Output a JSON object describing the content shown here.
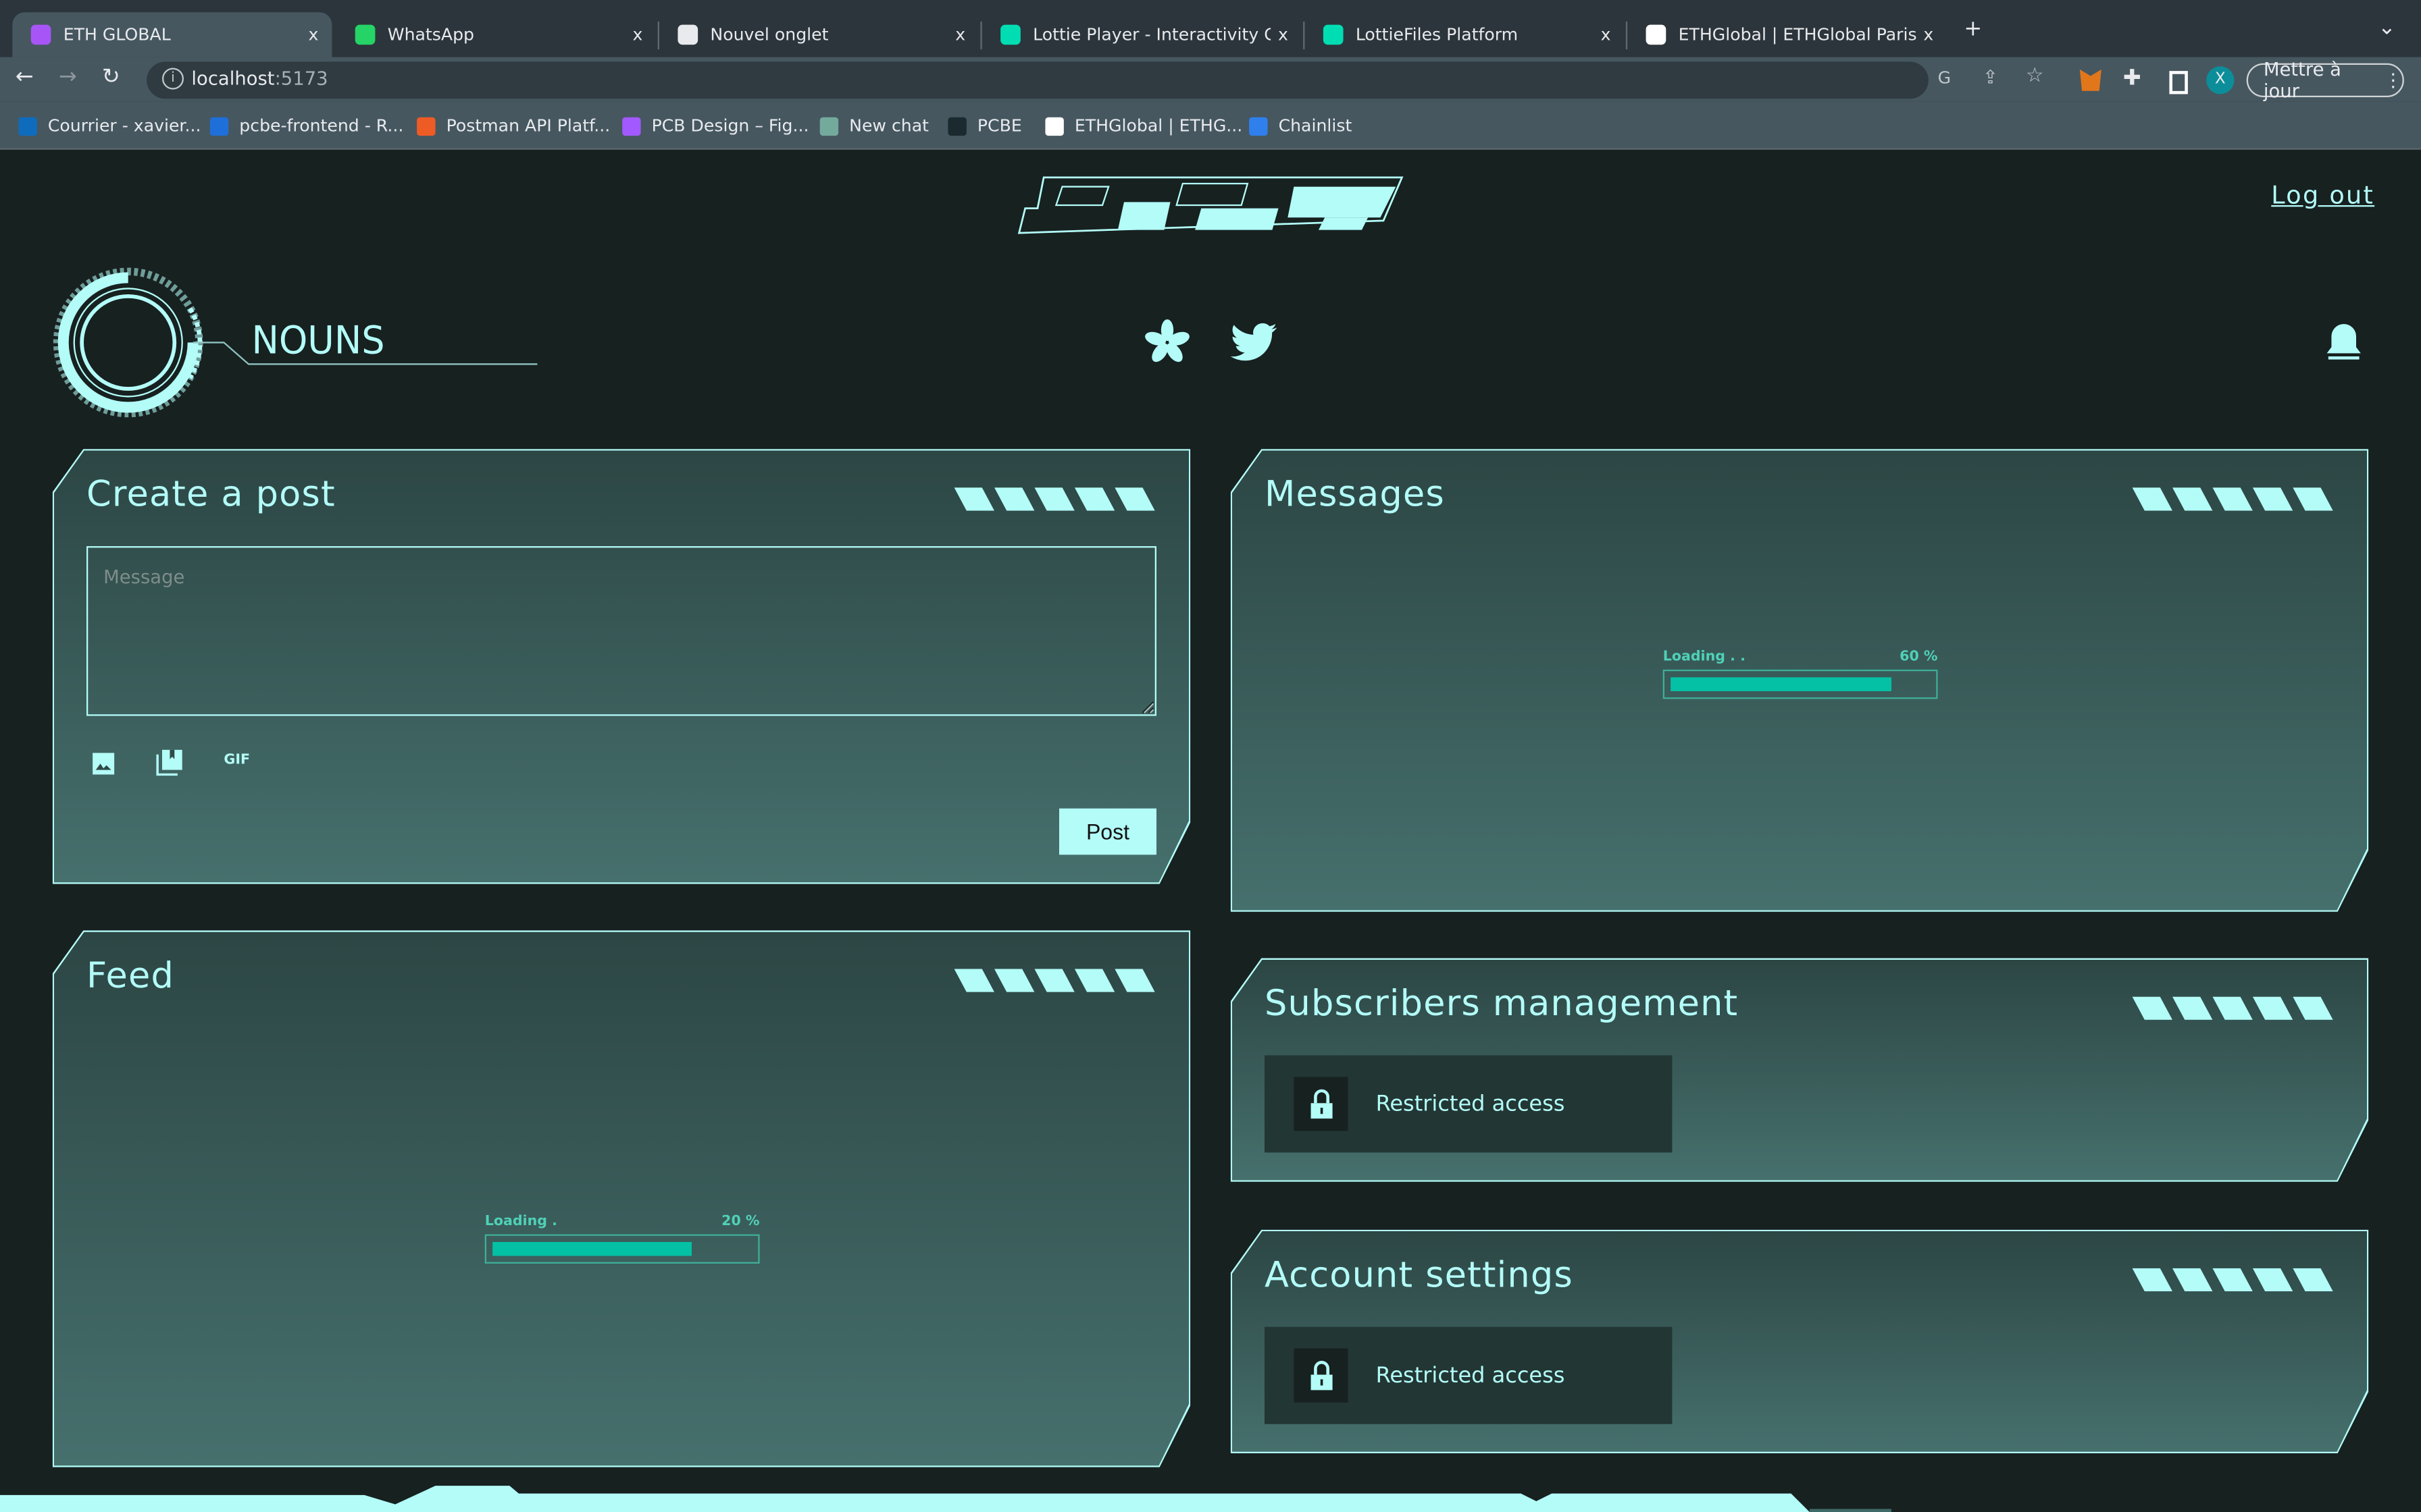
{
  "browser": {
    "tabs": [
      {
        "title": "ETH GLOBAL",
        "active": true,
        "icon": "vite-icon",
        "color": "#a855f7"
      },
      {
        "title": "WhatsApp",
        "icon": "whatsapp-icon",
        "color": "#25d366"
      },
      {
        "title": "Nouvel onglet",
        "icon": "chrome-icon",
        "color": "#e8eaed"
      },
      {
        "title": "Lottie Player - Interactivity Guide",
        "icon": "lottie-icon",
        "color": "#00ddb3"
      },
      {
        "title": "LottieFiles Platform",
        "icon": "lottie-icon",
        "color": "#00ddb3"
      },
      {
        "title": "ETHGlobal | ETHGlobal Paris",
        "icon": "ethglobal-icon",
        "color": "#ffffff"
      }
    ],
    "close_glyph": "x",
    "new_tab_glyph": "+",
    "tab_menu_glyph": "⌄",
    "url_host": "localhost",
    "url_port": ":5173",
    "profile_initial": "X",
    "update_label": "Mettre à jour",
    "bookmarks": [
      {
        "label": "Courrier - xavier...",
        "color": "#0f6cbd"
      },
      {
        "label": "pcbe-frontend - R...",
        "color": "#1e6fd9"
      },
      {
        "label": "Postman API Platf...",
        "color": "#ef5b25"
      },
      {
        "label": "PCB Design – Fig...",
        "color": "#a259ff"
      },
      {
        "label": "New chat",
        "color": "#74aa9c"
      },
      {
        "label": "PCBE",
        "color": "#1b2a2e"
      },
      {
        "label": "ETHGlobal | ETHG...",
        "color": "#ffffff"
      },
      {
        "label": "Chainlist",
        "color": "#2f80ed"
      }
    ]
  },
  "header": {
    "logout_label": "Log out",
    "community_name": "NOUNS"
  },
  "colors": {
    "accent": "#b3fcf8",
    "background": "#172120",
    "progress": "#04c1a5"
  },
  "create_post": {
    "title": "Create a post",
    "placeholder": "Message",
    "gif_label": "GIF",
    "post_label": "Post"
  },
  "messages": {
    "title": "Messages",
    "loading_label": "Loading . .",
    "progress_label": "60 %",
    "progress": 60
  },
  "feed": {
    "title": "Feed",
    "loading_label": "Loading .",
    "progress_label": "20 %",
    "progress": 20
  },
  "subscribers": {
    "title": "Subscribers management",
    "restricted_label": "Restricted access"
  },
  "account": {
    "title": "Account settings",
    "restricted_label": "Restricted access"
  }
}
